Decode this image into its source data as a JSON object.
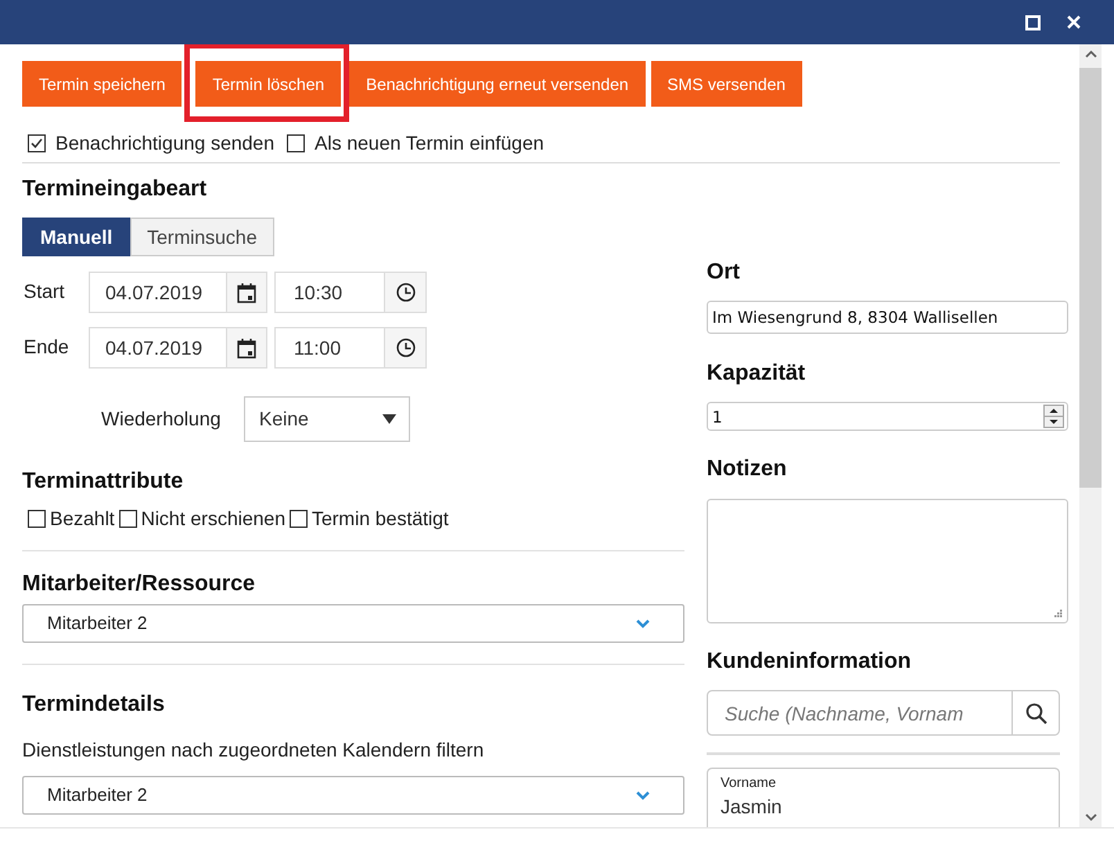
{
  "toolbar": {
    "buttons": [
      {
        "label": "Termin speichern",
        "highlighted": false
      },
      {
        "label": "Termin löschen",
        "highlighted": true
      },
      {
        "label": "Benachrichtigung erneut versenden",
        "highlighted": false
      },
      {
        "label": "SMS versenden",
        "highlighted": false
      }
    ]
  },
  "options": [
    {
      "label": "Benachrichtigung senden",
      "checked": true
    },
    {
      "label": "Als neuen Termin einfügen",
      "checked": false
    }
  ],
  "entry_mode": {
    "title": "Termineingabeart",
    "tabs": [
      {
        "label": "Manuell",
        "selected": true
      },
      {
        "label": "Terminsuche",
        "selected": false
      }
    ]
  },
  "schedule": {
    "rows": [
      {
        "label": "Start",
        "date": "04.07.2019",
        "time": "10:30"
      },
      {
        "label": "Ende",
        "date": "04.07.2019",
        "time": "11:00"
      }
    ],
    "repeat": {
      "label": "Wiederholung",
      "value": "Keine"
    }
  },
  "attributes": {
    "title": "Terminattribute",
    "items": [
      {
        "label": "Bezahlt",
        "checked": false
      },
      {
        "label": "Nicht erschienen",
        "checked": false
      },
      {
        "label": "Termin bestätigt",
        "checked": false
      }
    ]
  },
  "resource": {
    "title": "Mitarbeiter/Ressource",
    "value": "Mitarbeiter 2"
  },
  "details": {
    "title": "Termindetails",
    "filter_label": "Dienstleistungen nach zugeordneten Kalendern filtern",
    "value": "Mitarbeiter 2"
  },
  "location": {
    "title": "Ort",
    "value": "Im Wiesengrund 8, 8304 Wallisellen"
  },
  "capacity": {
    "title": "Kapazität",
    "value": "1"
  },
  "notes": {
    "title": "Notizen"
  },
  "customer": {
    "title": "Kundeninformation",
    "search": {
      "placeholder": "Suche (Nachname, Vornam"
    },
    "fields": [
      {
        "label": "Vorname",
        "value": "Jasmin"
      }
    ]
  }
}
